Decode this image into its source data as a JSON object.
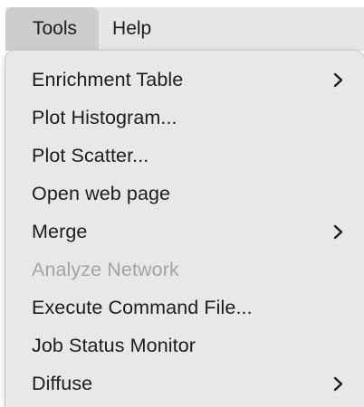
{
  "menubar": {
    "items": [
      {
        "label": "Tools",
        "active": true
      },
      {
        "label": "Help",
        "active": false
      }
    ]
  },
  "tools_menu": {
    "items": [
      {
        "label": "Enrichment Table",
        "submenu": true,
        "enabled": true
      },
      {
        "label": "Plot Histogram...",
        "submenu": false,
        "enabled": true
      },
      {
        "label": "Plot Scatter...",
        "submenu": false,
        "enabled": true
      },
      {
        "label": "Open web page",
        "submenu": false,
        "enabled": true
      },
      {
        "label": "Merge",
        "submenu": true,
        "enabled": true
      },
      {
        "label": "Analyze Network",
        "submenu": false,
        "enabled": false
      },
      {
        "label": "Execute Command File...",
        "submenu": false,
        "enabled": true
      },
      {
        "label": "Job Status Monitor",
        "submenu": false,
        "enabled": true
      },
      {
        "label": "Diffuse",
        "submenu": true,
        "enabled": true
      }
    ]
  },
  "icons": {
    "submenu_indicator": "chevron-right-icon"
  },
  "colors": {
    "menu_background": "#e8e8e8",
    "menubar_background": "#e6e6e6",
    "active_menubar_item": "#cdcdcd",
    "text": "#1c1c1c",
    "disabled_text": "#a3a3a3"
  }
}
